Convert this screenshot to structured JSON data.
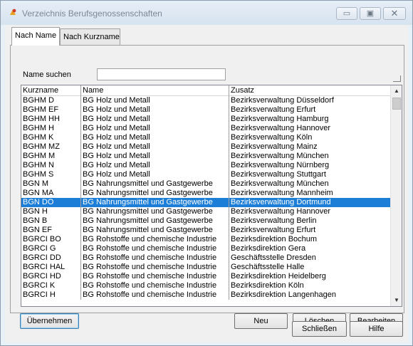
{
  "window": {
    "title": "Verzeichnis Berufsgenossenschaften",
    "controls": {
      "minimize": "▭",
      "maximize": "▣",
      "close": "✕"
    }
  },
  "tabs": [
    {
      "label": "Nach Name",
      "active": true
    },
    {
      "label": "Nach Kurzname",
      "active": false
    }
  ],
  "search": {
    "label": "Name suchen",
    "value": ""
  },
  "table": {
    "columns": [
      "Kurzname",
      "Name",
      "Zusatz"
    ],
    "rows": [
      [
        "BGHM D",
        "BG Holz und Metall",
        "Bezirksverwaltung Düsseldorf"
      ],
      [
        "BGHM EF",
        "BG Holz und Metall",
        "Bezirksverwaltung Erfurt"
      ],
      [
        "BGHM HH",
        "BG Holz und Metall",
        "Bezirksverwaltung Hamburg"
      ],
      [
        "BGHM H",
        "BG Holz und Metall",
        "Bezirksverwaltung Hannover"
      ],
      [
        "BGHM K",
        "BG Holz und Metall",
        "Bezirksverwaltung Köln"
      ],
      [
        "BGHM MZ",
        "BG Holz und Metall",
        "Bezirksverwaltung Mainz"
      ],
      [
        "BGHM M",
        "BG Holz und Metall",
        "Bezirksverwaltung München"
      ],
      [
        "BGHM N",
        "BG Holz und Metall",
        "Bezirksverwaltung Nürnberg"
      ],
      [
        "BGHM S",
        "BG Holz und Metall",
        "Bezirksverwaltung Stuttgart"
      ],
      [
        "BGN M",
        "BG Nahrungsmittel und Gastgewerbe",
        "Bezirksverwaltung München"
      ],
      [
        "BGN MA",
        "BG Nahrungsmittel und Gastgewerbe",
        "Bezirksverwaltung Mannheim"
      ],
      [
        "BGN DO",
        "BG Nahrungsmittel und Gastgewerbe",
        "Bezirksverwaltung Dortmund"
      ],
      [
        "BGN H",
        "BG Nahrungsmittel und Gastgewerbe",
        "Bezirksverwaltung Hannover"
      ],
      [
        "BGN B",
        "BG Nahrungsmittel und Gastgewerbe",
        "Bezirksverwaltung Berlin"
      ],
      [
        "BGN EF",
        "BG Nahrungsmittel und Gastgewerbe",
        "Bezirksverwaltung Erfurt"
      ],
      [
        "BGRCI BO",
        "BG Rohstoffe und chemische Industrie",
        "Bezirksdirektion Bochum"
      ],
      [
        "BGRCI G",
        "BG Rohstoffe und chemische Industrie",
        "Bezirksdirektion Gera"
      ],
      [
        "BGRCI DD",
        "BG Rohstoffe und chemische Industrie",
        "Geschäftsstelle Dresden"
      ],
      [
        "BGRCI HAL",
        "BG Rohstoffe und chemische Industrie",
        "Geschäftsstelle Halle"
      ],
      [
        "BGRCI HD",
        "BG Rohstoffe und chemische Industrie",
        "Bezirksdirektion Heidelberg"
      ],
      [
        "BGRCI K",
        "BG Rohstoffe und chemische Industrie",
        "Bezirksdirektion Köln"
      ],
      [
        "BGRCI H",
        "BG Rohstoffe und chemische Industrie",
        "Bezirksdirektion Langenhagen"
      ]
    ],
    "selected_row": 11,
    "selection_color": "#1c7ed6",
    "scrollbar": {
      "up_icon": "▲",
      "down_icon": "▼"
    }
  },
  "buttons": {
    "uebernehmen": "Übernehmen",
    "neu": "Neu",
    "loeschen": "Löschen",
    "bearbeiten": "Bearbeiten",
    "schliessen": "Schließen",
    "hilfe": "Hilfe"
  },
  "icons": {
    "app": "app-icon"
  }
}
